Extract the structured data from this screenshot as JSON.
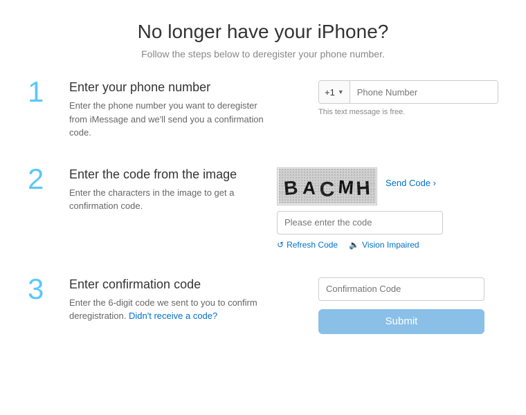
{
  "header": {
    "title": "No longer have your iPhone?",
    "subtitle": "Follow the steps below to deregister your phone number."
  },
  "steps": [
    {
      "number": "1",
      "heading": "Enter your phone number",
      "description": "Enter the phone number you want to deregister from iMessage and we'll send you a confirmation code.",
      "control_type": "phone",
      "country_code": "+1",
      "phone_placeholder": "Phone Number",
      "phone_note": "This text message is free."
    },
    {
      "number": "2",
      "heading": "Enter the code from the image",
      "description": "Enter the characters in the image to get a confirmation code.",
      "control_type": "captcha",
      "captcha_text": "BACMH",
      "send_code_label": "Send Code ›",
      "code_placeholder": "Please enter the code",
      "refresh_label": "Refresh Code",
      "vision_label": "Vision Impaired"
    },
    {
      "number": "3",
      "heading": "Enter confirmation code",
      "description_before": "Enter the 6-digit code we sent to you to confirm deregistration.",
      "link_text": "Didn't receive a code?",
      "control_type": "confirmation",
      "confirm_placeholder": "Confirmation Code",
      "submit_label": "Submit"
    }
  ],
  "colors": {
    "accent": "#5ac8fa",
    "link": "#0070c9",
    "submit_bg": "#8abfe8"
  }
}
